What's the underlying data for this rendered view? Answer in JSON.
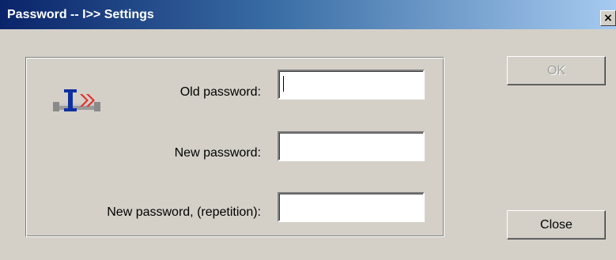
{
  "window": {
    "title": "Password -- I>> Settings",
    "close_glyph": "×"
  },
  "form": {
    "old_password_label": "Old password:",
    "new_password_label": "New password:",
    "repeat_password_label": "New password, (repetition):",
    "old_password_value": "",
    "new_password_value": "",
    "repeat_password_value": ""
  },
  "buttons": {
    "ok_label": "OK",
    "close_label": "Close"
  },
  "icons": {
    "logo": "app-logo-icon",
    "close": "close-icon"
  },
  "colors": {
    "title_gradient_start": "#0a246a",
    "title_gradient_end": "#a6caf0",
    "dialog_bg": "#d4d0c8",
    "logo_accent": "#e03030",
    "logo_blue": "#1030a0"
  }
}
